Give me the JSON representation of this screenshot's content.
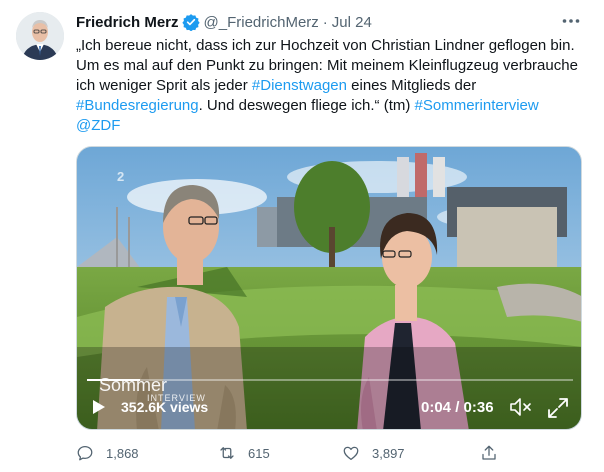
{
  "author": {
    "name": "Friedrich Merz",
    "handle": "@_FriedrichMerz",
    "separator": "·",
    "date": "Jul 24"
  },
  "tweet": {
    "lines": [
      [
        {
          "t": "„Ich bereue nicht, dass ich zur Hochzeit von Christian Lindner geflogen bin.",
          "tag": false
        }
      ],
      [
        {
          "t": "Um es mal auf den Punkt zu bringen: Mit meinem Kleinflugzeug verbrauche",
          "tag": false
        }
      ],
      [
        {
          "t": "ich weniger Sprit als jeder ",
          "tag": false
        },
        {
          "t": "#Dienstwagen",
          "tag": true
        },
        {
          "t": " eines Mitglieds der",
          "tag": false
        }
      ],
      [
        {
          "t": "#Bundesregierung",
          "tag": true
        },
        {
          "t": ". Und deswegen fliege ich.“ (tm) ",
          "tag": false
        },
        {
          "t": "#Sommerinterview",
          "tag": true
        }
      ],
      [
        {
          "t": "@ZDF",
          "tag": true
        }
      ]
    ]
  },
  "video": {
    "logo_line1": "Sommer",
    "logo_line2": "INTERVIEW",
    "channel_mark": "2",
    "views": "352.6K views",
    "time": "0:04 / 0:36",
    "progress": 0.11
  },
  "actions": {
    "replies": "1,868",
    "retweets": "615",
    "likes": "3,897"
  },
  "colors": {
    "accent": "#1d9bf0",
    "muted": "#536471"
  },
  "icons": [
    "verified-badge-icon",
    "more-icon",
    "play-icon",
    "mute-icon",
    "fullscreen-icon",
    "reply-icon",
    "retweet-icon",
    "like-icon",
    "share-icon"
  ]
}
